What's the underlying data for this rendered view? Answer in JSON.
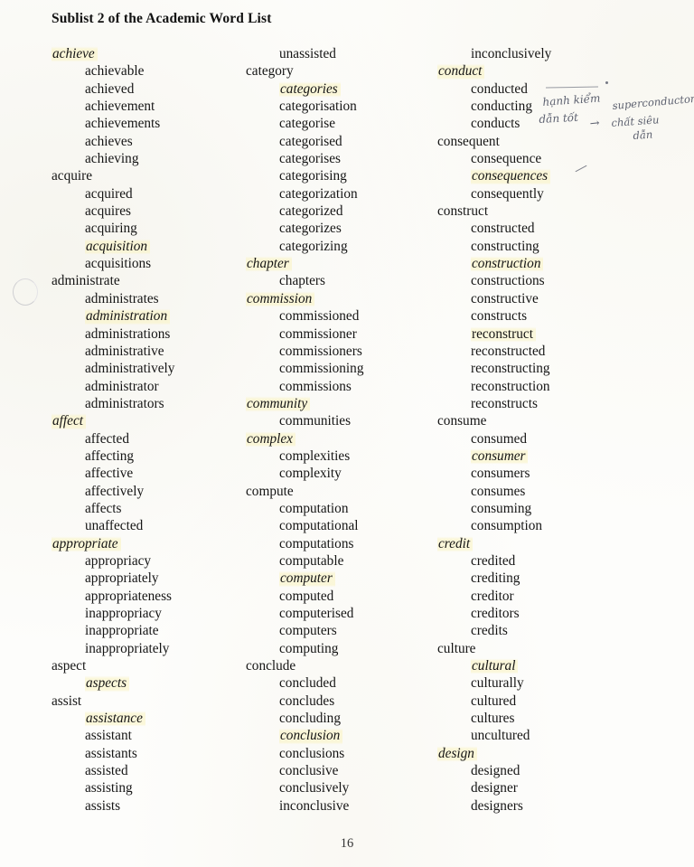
{
  "document": {
    "title": "Sublist 2 of the Academic Word List",
    "page_number": "16",
    "paper_color": "#fdfdfb",
    "highlight_color": "#faf4c6",
    "ink_color": "#151515"
  },
  "annotations": {
    "handwriting": {
      "line_1": "hạnh kiểm",
      "line_2": "dẫn tốt",
      "arrow": "→",
      "line_3": "superconductor",
      "line_4": "chất siêu",
      "line_5": "dẫn"
    }
  },
  "columns": [
    {
      "id": "column-1",
      "entries": [
        {
          "text": "achieve",
          "level": "head",
          "style": "ital"
        },
        {
          "text": "achievable",
          "level": "deriv",
          "style": "plain"
        },
        {
          "text": "achieved",
          "level": "deriv",
          "style": "plain"
        },
        {
          "text": "achievement",
          "level": "deriv",
          "style": "plain"
        },
        {
          "text": "achievements",
          "level": "deriv",
          "style": "plain"
        },
        {
          "text": "achieves",
          "level": "deriv",
          "style": "plain"
        },
        {
          "text": "achieving",
          "level": "deriv",
          "style": "plain"
        },
        {
          "text": "acquire",
          "level": "head",
          "style": "plain"
        },
        {
          "text": "acquired",
          "level": "deriv",
          "style": "plain"
        },
        {
          "text": "acquires",
          "level": "deriv",
          "style": "plain"
        },
        {
          "text": "acquiring",
          "level": "deriv",
          "style": "plain"
        },
        {
          "text": "acquisition",
          "level": "deriv",
          "style": "ital"
        },
        {
          "text": "acquisitions",
          "level": "deriv",
          "style": "plain"
        },
        {
          "text": "administrate",
          "level": "head",
          "style": "plain"
        },
        {
          "text": "administrates",
          "level": "deriv",
          "style": "plain"
        },
        {
          "text": "administration",
          "level": "deriv",
          "style": "ital"
        },
        {
          "text": "administrations",
          "level": "deriv",
          "style": "plain"
        },
        {
          "text": "administrative",
          "level": "deriv",
          "style": "plain"
        },
        {
          "text": "administratively",
          "level": "deriv",
          "style": "plain"
        },
        {
          "text": "administrator",
          "level": "deriv",
          "style": "plain"
        },
        {
          "text": "administrators",
          "level": "deriv",
          "style": "plain"
        },
        {
          "text": "affect",
          "level": "head",
          "style": "ital"
        },
        {
          "text": "affected",
          "level": "deriv",
          "style": "plain"
        },
        {
          "text": "affecting",
          "level": "deriv",
          "style": "plain"
        },
        {
          "text": "affective",
          "level": "deriv",
          "style": "plain"
        },
        {
          "text": "affectively",
          "level": "deriv",
          "style": "plain"
        },
        {
          "text": "affects",
          "level": "deriv",
          "style": "plain"
        },
        {
          "text": "unaffected",
          "level": "deriv",
          "style": "plain"
        },
        {
          "text": "appropriate",
          "level": "head",
          "style": "ital"
        },
        {
          "text": "appropriacy",
          "level": "deriv",
          "style": "plain"
        },
        {
          "text": "appropriately",
          "level": "deriv",
          "style": "plain"
        },
        {
          "text": "appropriateness",
          "level": "deriv",
          "style": "plain"
        },
        {
          "text": "inappropriacy",
          "level": "deriv",
          "style": "plain"
        },
        {
          "text": "inappropriate",
          "level": "deriv",
          "style": "plain"
        },
        {
          "text": "inappropriately",
          "level": "deriv",
          "style": "plain"
        },
        {
          "text": "aspect",
          "level": "head",
          "style": "plain"
        },
        {
          "text": "aspects",
          "level": "deriv",
          "style": "ital"
        },
        {
          "text": "assist",
          "level": "head",
          "style": "plain"
        },
        {
          "text": "assistance",
          "level": "deriv",
          "style": "ital"
        },
        {
          "text": "assistant",
          "level": "deriv",
          "style": "plain"
        },
        {
          "text": "assistants",
          "level": "deriv",
          "style": "plain"
        },
        {
          "text": "assisted",
          "level": "deriv",
          "style": "plain"
        },
        {
          "text": "assisting",
          "level": "deriv",
          "style": "plain"
        },
        {
          "text": "assists",
          "level": "deriv",
          "style": "plain"
        }
      ]
    },
    {
      "id": "column-2",
      "entries": [
        {
          "text": "unassisted",
          "level": "deriv",
          "style": "plain"
        },
        {
          "text": "category",
          "level": "head",
          "style": "plain"
        },
        {
          "text": "categories",
          "level": "deriv",
          "style": "ital"
        },
        {
          "text": "categorisation",
          "level": "deriv",
          "style": "plain"
        },
        {
          "text": "categorise",
          "level": "deriv",
          "style": "plain"
        },
        {
          "text": "categorised",
          "level": "deriv",
          "style": "plain"
        },
        {
          "text": "categorises",
          "level": "deriv",
          "style": "plain"
        },
        {
          "text": "categorising",
          "level": "deriv",
          "style": "plain"
        },
        {
          "text": "categorization",
          "level": "deriv",
          "style": "plain"
        },
        {
          "text": "categorized",
          "level": "deriv",
          "style": "plain"
        },
        {
          "text": "categorizes",
          "level": "deriv",
          "style": "plain"
        },
        {
          "text": "categorizing",
          "level": "deriv",
          "style": "plain"
        },
        {
          "text": "chapter",
          "level": "head",
          "style": "ital"
        },
        {
          "text": "chapters",
          "level": "deriv",
          "style": "plain"
        },
        {
          "text": "commission",
          "level": "head",
          "style": "ital"
        },
        {
          "text": "commissioned",
          "level": "deriv",
          "style": "plain"
        },
        {
          "text": "commissioner",
          "level": "deriv",
          "style": "plain"
        },
        {
          "text": "commissioners",
          "level": "deriv",
          "style": "plain"
        },
        {
          "text": "commissioning",
          "level": "deriv",
          "style": "plain"
        },
        {
          "text": "commissions",
          "level": "deriv",
          "style": "plain"
        },
        {
          "text": "community",
          "level": "head",
          "style": "ital"
        },
        {
          "text": "communities",
          "level": "deriv",
          "style": "plain"
        },
        {
          "text": "complex",
          "level": "head",
          "style": "ital"
        },
        {
          "text": "complexities",
          "level": "deriv",
          "style": "plain"
        },
        {
          "text": "complexity",
          "level": "deriv",
          "style": "plain"
        },
        {
          "text": "compute",
          "level": "head",
          "style": "plain"
        },
        {
          "text": "computation",
          "level": "deriv",
          "style": "plain"
        },
        {
          "text": "computational",
          "level": "deriv",
          "style": "plain"
        },
        {
          "text": "computations",
          "level": "deriv",
          "style": "plain"
        },
        {
          "text": "computable",
          "level": "deriv",
          "style": "plain"
        },
        {
          "text": "computer",
          "level": "deriv",
          "style": "ital"
        },
        {
          "text": "computed",
          "level": "deriv",
          "style": "plain"
        },
        {
          "text": "computerised",
          "level": "deriv",
          "style": "plain"
        },
        {
          "text": "computers",
          "level": "deriv",
          "style": "plain"
        },
        {
          "text": "computing",
          "level": "deriv",
          "style": "plain"
        },
        {
          "text": "conclude",
          "level": "head",
          "style": "plain"
        },
        {
          "text": "concluded",
          "level": "deriv",
          "style": "plain"
        },
        {
          "text": "concludes",
          "level": "deriv",
          "style": "plain"
        },
        {
          "text": "concluding",
          "level": "deriv",
          "style": "plain"
        },
        {
          "text": "conclusion",
          "level": "deriv",
          "style": "ital"
        },
        {
          "text": "conclusions",
          "level": "deriv",
          "style": "plain"
        },
        {
          "text": "conclusive",
          "level": "deriv",
          "style": "plain"
        },
        {
          "text": "conclusively",
          "level": "deriv",
          "style": "plain"
        },
        {
          "text": "inconclusive",
          "level": "deriv",
          "style": "plain"
        }
      ]
    },
    {
      "id": "column-3",
      "entries": [
        {
          "text": "inconclusively",
          "level": "deriv",
          "style": "plain"
        },
        {
          "text": "conduct",
          "level": "head",
          "style": "ital"
        },
        {
          "text": "conducted",
          "level": "deriv",
          "style": "plain"
        },
        {
          "text": "conducting",
          "level": "deriv",
          "style": "plain"
        },
        {
          "text": "conducts",
          "level": "deriv",
          "style": "plain"
        },
        {
          "text": "consequent",
          "level": "head",
          "style": "plain"
        },
        {
          "text": "consequence",
          "level": "deriv",
          "style": "plain"
        },
        {
          "text": "consequences",
          "level": "deriv",
          "style": "ital"
        },
        {
          "text": "consequently",
          "level": "deriv",
          "style": "plain"
        },
        {
          "text": "construct",
          "level": "head",
          "style": "plain"
        },
        {
          "text": "constructed",
          "level": "deriv",
          "style": "plain"
        },
        {
          "text": "constructing",
          "level": "deriv",
          "style": "plain"
        },
        {
          "text": "construction",
          "level": "deriv",
          "style": "ital"
        },
        {
          "text": "constructions",
          "level": "deriv",
          "style": "plain"
        },
        {
          "text": "constructive",
          "level": "deriv",
          "style": "plain"
        },
        {
          "text": "constructs",
          "level": "deriv",
          "style": "plain"
        },
        {
          "text": "reconstruct",
          "level": "deriv",
          "style": "hl"
        },
        {
          "text": "reconstructed",
          "level": "deriv",
          "style": "plain"
        },
        {
          "text": "reconstructing",
          "level": "deriv",
          "style": "plain"
        },
        {
          "text": "reconstruction",
          "level": "deriv",
          "style": "plain"
        },
        {
          "text": "reconstructs",
          "level": "deriv",
          "style": "plain"
        },
        {
          "text": "consume",
          "level": "head",
          "style": "plain"
        },
        {
          "text": "consumed",
          "level": "deriv",
          "style": "plain"
        },
        {
          "text": "consumer",
          "level": "deriv",
          "style": "ital"
        },
        {
          "text": "consumers",
          "level": "deriv",
          "style": "plain"
        },
        {
          "text": "consumes",
          "level": "deriv",
          "style": "plain"
        },
        {
          "text": "consuming",
          "level": "deriv",
          "style": "plain"
        },
        {
          "text": "consumption",
          "level": "deriv",
          "style": "plain"
        },
        {
          "text": "credit",
          "level": "head",
          "style": "ital"
        },
        {
          "text": "credited",
          "level": "deriv",
          "style": "plain"
        },
        {
          "text": "crediting",
          "level": "deriv",
          "style": "plain"
        },
        {
          "text": "creditor",
          "level": "deriv",
          "style": "plain"
        },
        {
          "text": "creditors",
          "level": "deriv",
          "style": "plain"
        },
        {
          "text": "credits",
          "level": "deriv",
          "style": "plain"
        },
        {
          "text": "culture",
          "level": "head",
          "style": "plain"
        },
        {
          "text": "cultural",
          "level": "deriv",
          "style": "ital"
        },
        {
          "text": "culturally",
          "level": "deriv",
          "style": "plain"
        },
        {
          "text": "cultured",
          "level": "deriv",
          "style": "plain"
        },
        {
          "text": "cultures",
          "level": "deriv",
          "style": "plain"
        },
        {
          "text": "uncultured",
          "level": "deriv",
          "style": "plain"
        },
        {
          "text": "design",
          "level": "head",
          "style": "ital"
        },
        {
          "text": "designed",
          "level": "deriv",
          "style": "plain"
        },
        {
          "text": "designer",
          "level": "deriv",
          "style": "plain"
        },
        {
          "text": "designers",
          "level": "deriv",
          "style": "plain"
        }
      ]
    }
  ]
}
